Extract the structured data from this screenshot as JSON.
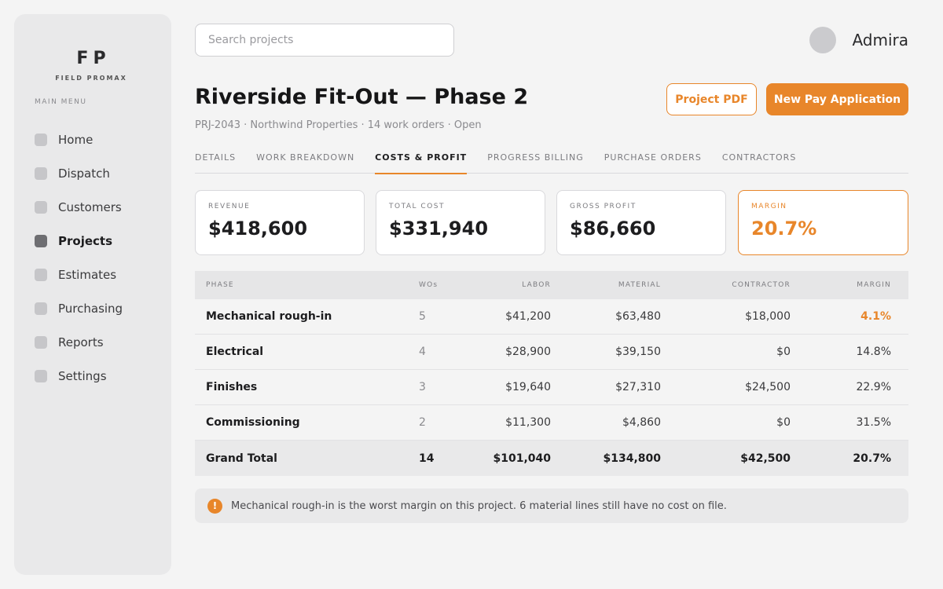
{
  "brand": {
    "mark": "FP",
    "name": "FIELD PROMAX"
  },
  "sidebar": {
    "menu_label": "MAIN MENU",
    "items": [
      {
        "label": "Home",
        "icon": "home-icon"
      },
      {
        "label": "Dispatch",
        "icon": "dispatch-icon"
      },
      {
        "label": "Customers",
        "icon": "customers-icon"
      },
      {
        "label": "Projects",
        "icon": "projects-icon",
        "active": true
      },
      {
        "label": "Estimates",
        "icon": "estimates-icon"
      },
      {
        "label": "Purchasing",
        "icon": "purchasing-icon"
      },
      {
        "label": "Reports",
        "icon": "reports-icon"
      },
      {
        "label": "Settings",
        "icon": "settings-icon"
      }
    ]
  },
  "search": {
    "placeholder": "Search projects",
    "value": ""
  },
  "user": {
    "name": "Admira"
  },
  "project": {
    "title": "Riverside Fit-Out — Phase 2",
    "subtitle": "PRJ-2043 · Northwind Properties · 14 work orders · Open"
  },
  "actions": {
    "pdf_label": "Project PDF",
    "new_pay_label": "New Pay Application"
  },
  "tabs": [
    {
      "label": "DETAILS"
    },
    {
      "label": "WORK BREAKDOWN"
    },
    {
      "label": "COSTS & PROFIT",
      "active": true
    },
    {
      "label": "PROGRESS BILLING"
    },
    {
      "label": "PURCHASE ORDERS"
    },
    {
      "label": "CONTRACTORS"
    }
  ],
  "kpis": {
    "revenue": {
      "label": "REVENUE",
      "value": "$418,600"
    },
    "total_cost": {
      "label": "TOTAL COST",
      "value": "$331,940"
    },
    "gross_profit": {
      "label": "GROSS PROFIT",
      "value": "$86,660"
    },
    "margin": {
      "label": "MARGIN",
      "value": "20.7%"
    }
  },
  "table": {
    "headers": {
      "phase": "PHASE",
      "wos": "WOs",
      "labor": "LABOR",
      "material": "MATERIAL",
      "contractor": "CONTRACTOR",
      "margin": "MARGIN"
    },
    "rows": [
      {
        "phase": "Mechanical rough-in",
        "wos": "5",
        "labor": "$41,200",
        "material": "$63,480",
        "contractor": "$18,000",
        "margin": "4.1%"
      },
      {
        "phase": "Electrical",
        "wos": "4",
        "labor": "$28,900",
        "material": "$39,150",
        "contractor": "$0",
        "margin": "14.8%"
      },
      {
        "phase": "Finishes",
        "wos": "3",
        "labor": "$19,640",
        "material": "$27,310",
        "contractor": "$24,500",
        "margin": "22.9%"
      },
      {
        "phase": "Commissioning",
        "wos": "2",
        "labor": "$11,300",
        "material": "$4,860",
        "contractor": "$0",
        "margin": "31.5%"
      }
    ],
    "total": {
      "phase": "Grand Total",
      "wos": "14",
      "labor": "$101,040",
      "material": "$134,800",
      "contractor": "$42,500",
      "margin": "20.7%"
    }
  },
  "notice": {
    "icon": "!",
    "text": "Mechanical rough-in is the worst margin on this project. 6 material lines still have no cost on file."
  },
  "colors": {
    "accent": "#e8862a",
    "sidebar_bg": "#e9e9ea",
    "page_bg": "#f4f4f4"
  }
}
